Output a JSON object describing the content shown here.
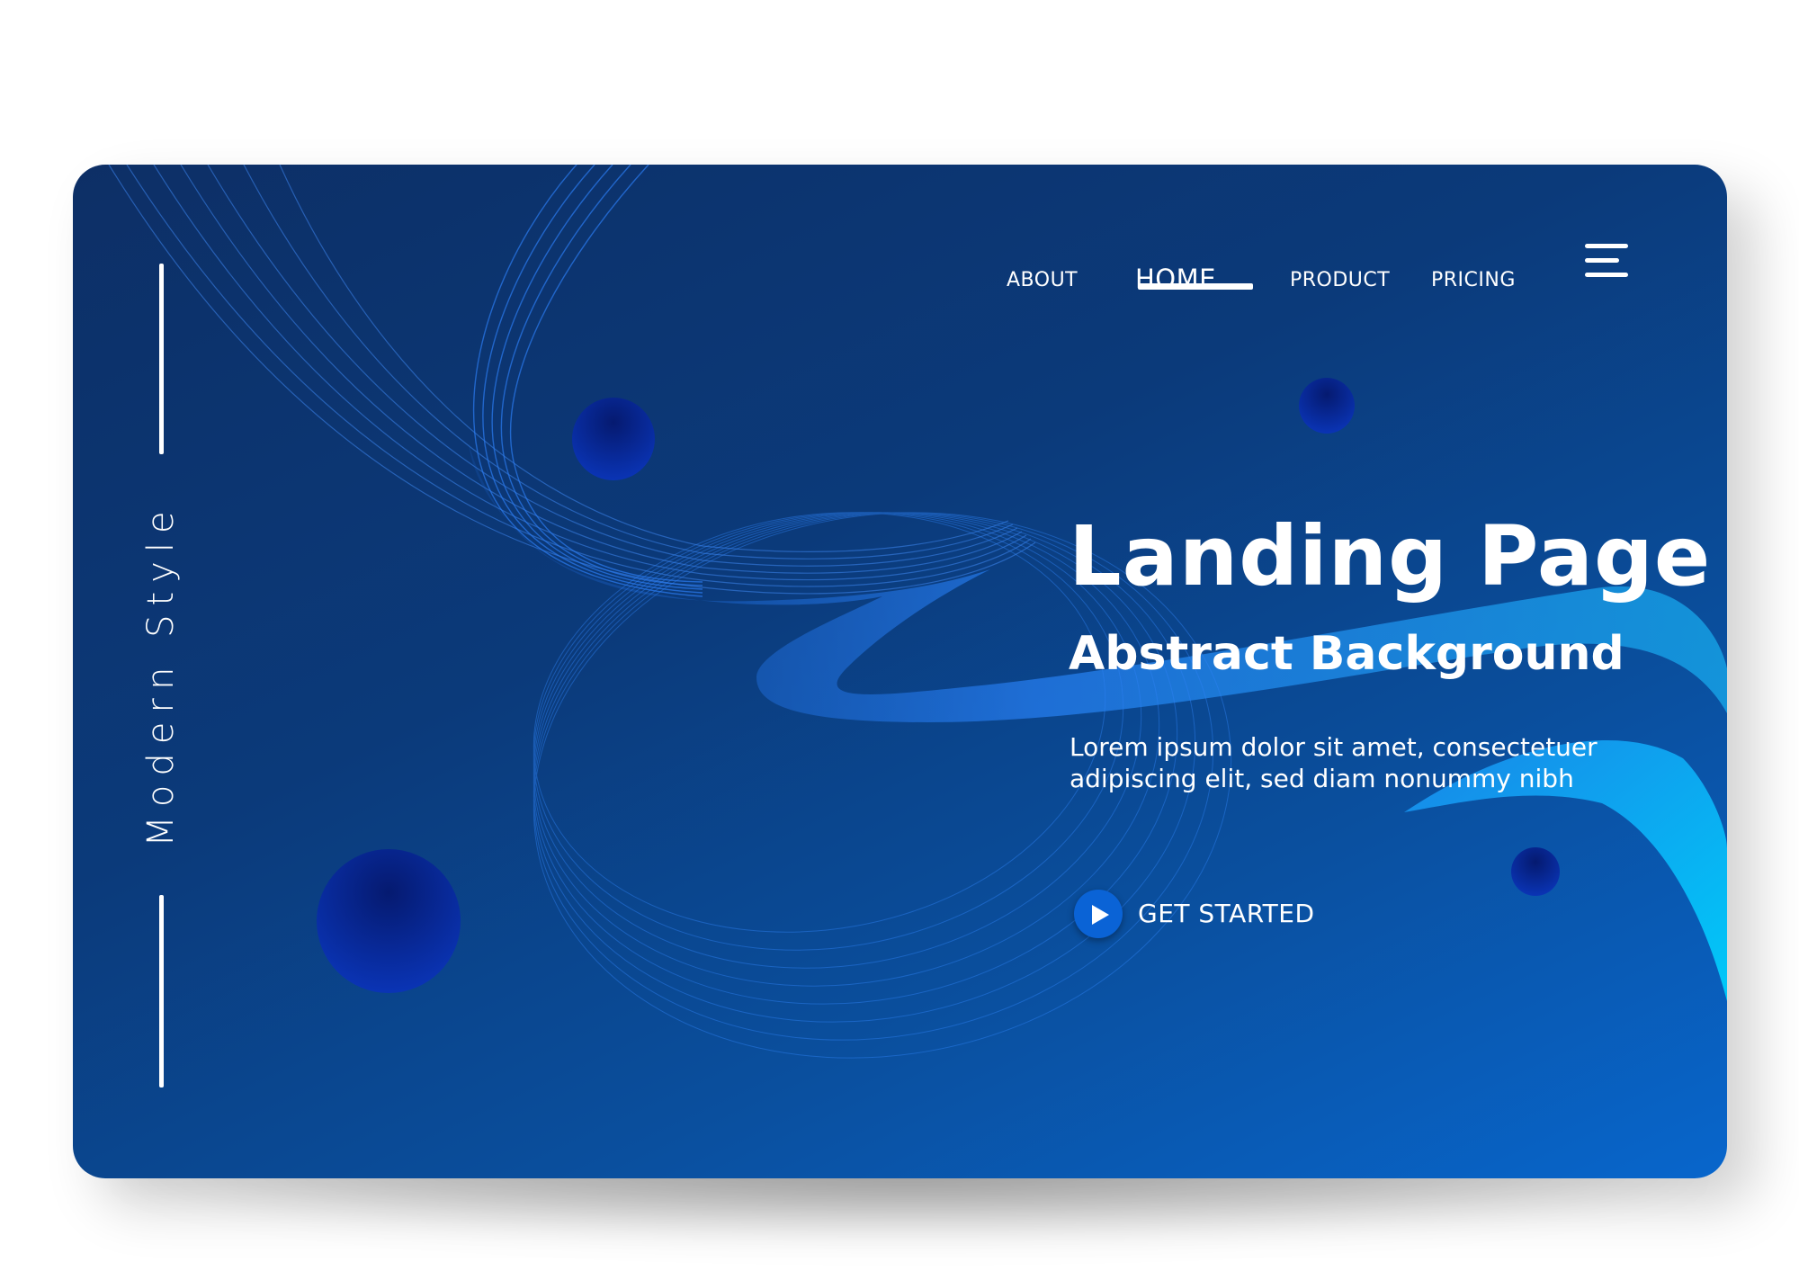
{
  "side": {
    "label": "Modern Style"
  },
  "nav": {
    "items": [
      {
        "label": "ABOUT"
      },
      {
        "label": "HOME"
      },
      {
        "label": "PRODUCT"
      },
      {
        "label": "PRICING"
      }
    ],
    "active": "HOME",
    "menu_icon": "hamburger-menu-icon"
  },
  "hero": {
    "title": "Landing Page",
    "subtitle": "Abstract Background",
    "body": "Lorem ipsum dolor sit amet, consectetuer adipiscing elit, sed diam nonummy nibh",
    "cta_label": "GET STARTED",
    "cta_icon": "play-icon"
  },
  "colors": {
    "background_dark": "#0d2f66",
    "background_light": "#0866cc",
    "wave": "#1f7ff0",
    "accent_cyan": "#00c6f5",
    "circle": "#0a2fa8",
    "text": "#ffffff"
  }
}
